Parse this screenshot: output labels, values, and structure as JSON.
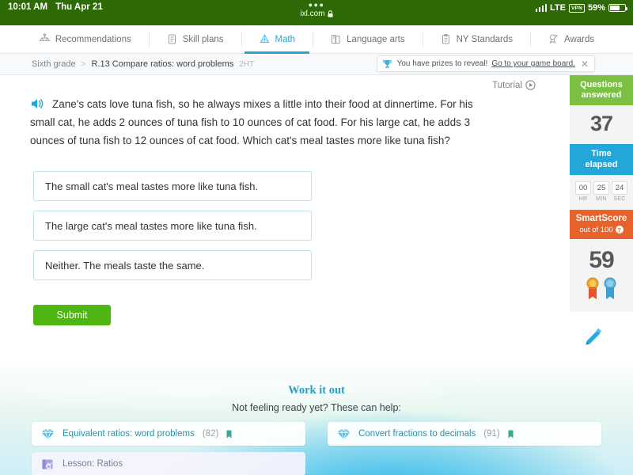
{
  "status_bar": {
    "time": "10:01 AM",
    "date": "Thu Apr 21",
    "url": "ixl.com",
    "lock_icon": "lock-icon",
    "network": "LTE",
    "vpn_badge": "VPN",
    "battery_percent": "59%"
  },
  "nav": {
    "tabs": [
      {
        "label": "Recommendations",
        "icon": "recommendations-icon",
        "active": false
      },
      {
        "label": "Skill plans",
        "icon": "skill-plans-icon",
        "active": false
      },
      {
        "label": "Math",
        "icon": "math-icon",
        "active": true
      },
      {
        "label": "Language arts",
        "icon": "language-arts-icon",
        "active": false
      },
      {
        "label": "NY Standards",
        "icon": "standards-icon",
        "active": false
      },
      {
        "label": "Awards",
        "icon": "awards-icon",
        "active": false
      }
    ]
  },
  "breadcrumb": {
    "grade": "Sixth grade",
    "separator": ">",
    "skill": "R.13 Compare ratios: word problems",
    "code": "2HT"
  },
  "prize_banner": {
    "icon": "trophy-icon",
    "message": "You have prizes to reveal!",
    "link": "Go to your game board.",
    "close": "✕"
  },
  "tutorial": {
    "label": "Tutorial",
    "icon": "play-circle-icon"
  },
  "question": {
    "speaker_icon": "speaker-icon",
    "text": "Zane's cats love tuna fish, so he always mixes a little into their food at dinnertime. For his small cat, he adds 2 ounces of tuna fish to 10 ounces of cat food. For his large cat, he adds 3 ounces of tuna fish to 12 ounces of cat food. Which cat's meal tastes more like tuna fish?",
    "choices": [
      "The small cat's meal tastes more like tuna fish.",
      "The large cat's meal tastes more like tuna fish.",
      "Neither. The meals taste the same."
    ],
    "submit_label": "Submit",
    "pencil_icon": "pencil-icon"
  },
  "score_panel": {
    "questions_answered": {
      "title_line1": "Questions",
      "title_line2": "answered",
      "value": "37",
      "color": "#7bc043"
    },
    "time_elapsed": {
      "title_line1": "Time",
      "title_line2": "elapsed",
      "color": "#23a7d8",
      "hours": "00",
      "minutes": "25",
      "seconds": "24",
      "hr_label": "HR",
      "min_label": "MIN",
      "sec_label": "SEC"
    },
    "smartscore": {
      "title": "SmartScore",
      "subtitle": "out of 100",
      "help_icon": "question-mark-icon",
      "value": "59",
      "color": "#e8622c",
      "ribbon_1": "gold-ribbon-icon",
      "ribbon_2": "blue-ribbon-icon"
    }
  },
  "work_it_out": {
    "title": "Work it out",
    "subtitle": "Not feeling ready yet? These can help:",
    "cards": [
      {
        "icon": "diamond-icon",
        "name": "Equivalent ratios: word problems",
        "count": "(82)",
        "bookmark": "bookmark-icon",
        "type": "skill"
      },
      {
        "icon": "diamond-icon",
        "name": "Convert fractions to decimals",
        "count": "(91)",
        "bookmark": "bookmark-icon",
        "type": "skill"
      },
      {
        "icon": "lesson-icon",
        "name": "Lesson: Ratios",
        "count": "",
        "bookmark": "",
        "type": "lesson"
      }
    ]
  }
}
